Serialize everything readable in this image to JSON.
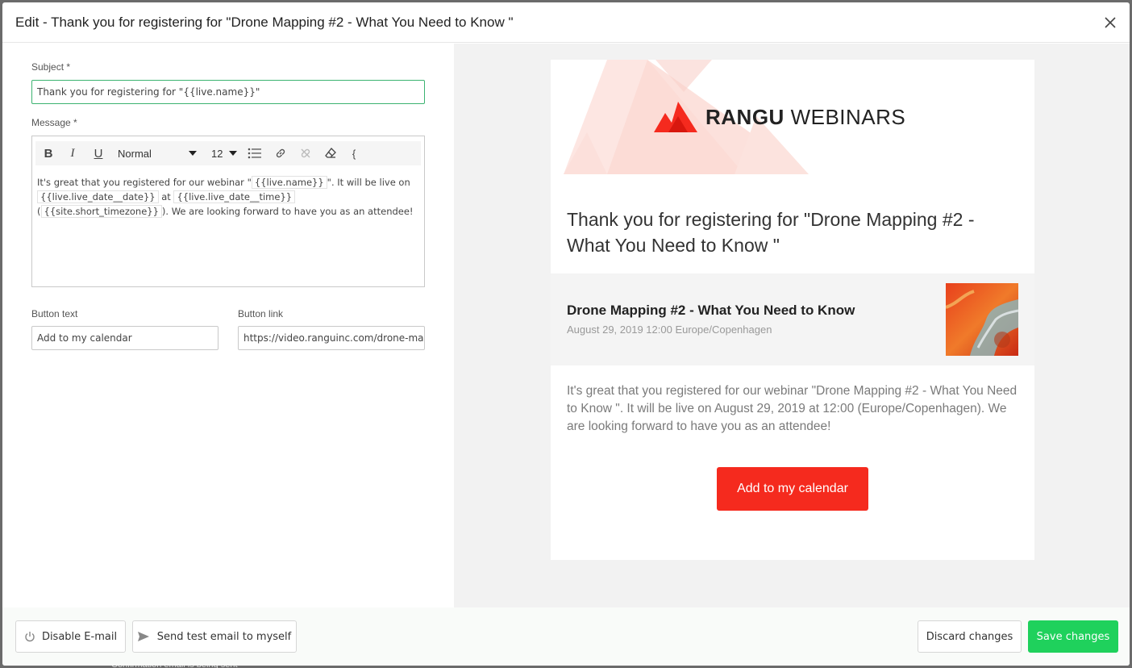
{
  "backdrop": {
    "text": "Confirmation email is being sent"
  },
  "modal": {
    "title": "Edit - Thank you for registering for \"Drone Mapping #2 - What You Need to Know \""
  },
  "form": {
    "subject_label": "Subject *",
    "subject_value": "Thank you for registering for \"{{live.name}}\"",
    "message_label": "Message *",
    "toolbar": {
      "bold": "B",
      "italic": "I",
      "underline": "U",
      "format_select": "Normal",
      "size_select": "12",
      "extra": "{"
    },
    "message": {
      "t1": "It's great that you registered for our webinar \"",
      "tag1": "{{live.name}}",
      "t2": "\". It will be live on",
      "tag2": "{{live.live_date__date}}",
      "t3": " at ",
      "tag3": "{{live.live_date__time}}",
      "t4": " (",
      "tag4": "{{site.short_timezone}}",
      "t5": "). We are looking forward to have you as an attendee!"
    },
    "button_text_label": "Button text",
    "button_text_value": "Add to my calendar",
    "button_link_label": "Button link",
    "button_link_value": "https://video.ranguinc.com/drone-mapping"
  },
  "preview": {
    "brand_bold": "RANGU",
    "brand_light": " WEBINARS",
    "heading": "Thank you for registering for \"Drone Mapping #2 - What You Need to Know \"",
    "event_title": "Drone Mapping #2 - What You Need to Know",
    "event_date": "August 29, 2019 12:00 Europe/Copenhagen",
    "body": "It's great that you registered for our webinar \"Drone Mapping #2 - What You Need to Know \". It will be live on August 29, 2019 at 12:00 (Europe/Copenhagen). We are looking forward to have you as an attendee!",
    "cta": "Add to my calendar",
    "brand_color": "#f52a1e"
  },
  "footer": {
    "disable_email": "Disable E-mail",
    "send_test": "Send test email to myself",
    "discard": "Discard changes",
    "save": "Save changes",
    "save_color": "#1fd15c"
  }
}
